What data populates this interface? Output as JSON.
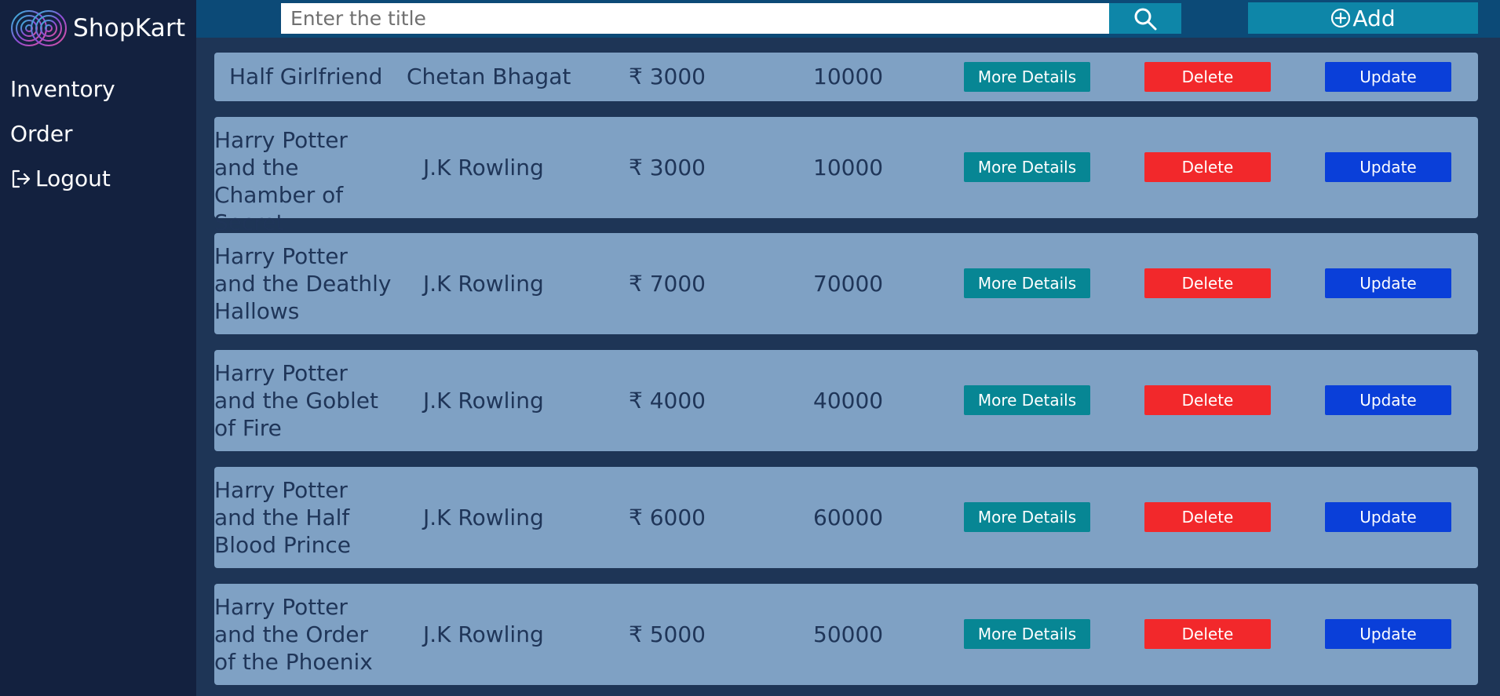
{
  "brand": {
    "name": "ShopKart"
  },
  "nav": {
    "inventory": "Inventory",
    "order": "Order",
    "logout": "Logout"
  },
  "search": {
    "placeholder": "Enter the title",
    "value": ""
  },
  "toolbar": {
    "add_label": "Add"
  },
  "actions": {
    "details_label": "More Details",
    "delete_label": "Delete",
    "update_label": "Update"
  },
  "books": [
    {
      "title": "Half Girlfriend",
      "author": "Chetan Bhagat",
      "price": "₹ 3000",
      "quantity": "10000"
    },
    {
      "title": "Harry Potter and the Chamber of Secret",
      "author": "J.K Rowling",
      "price": "₹ 3000",
      "quantity": "10000"
    },
    {
      "title": "Harry Potter and the Deathly Hallows",
      "author": "J.K Rowling",
      "price": "₹ 7000",
      "quantity": "70000"
    },
    {
      "title": "Harry Potter and the Goblet of Fire",
      "author": "J.K Rowling",
      "price": "₹ 4000",
      "quantity": "40000"
    },
    {
      "title": "Harry Potter and the Half Blood Prince",
      "author": "J.K Rowling",
      "price": "₹ 6000",
      "quantity": "60000"
    },
    {
      "title": "Harry Potter and the Order of the Phoenix",
      "author": "J.K Rowling",
      "price": "₹ 5000",
      "quantity": "50000"
    }
  ],
  "colors": {
    "sidebar": "#13213f",
    "topbar": "#0c4a77",
    "row": "#7fa1c4",
    "details": "#078694",
    "delete": "#f2282b",
    "update": "#0a3fd9"
  }
}
